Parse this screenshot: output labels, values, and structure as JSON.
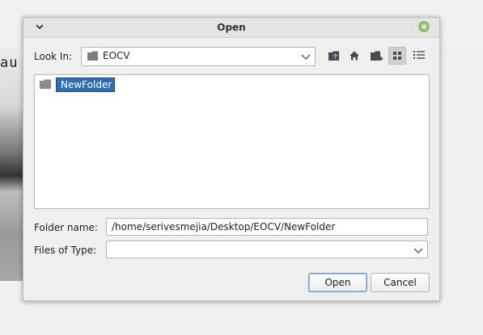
{
  "background": {
    "text": "au"
  },
  "dialog": {
    "title": "Open",
    "look_in_label": "Look In:",
    "look_in_value": "EOCV",
    "toolbar": [
      "up-one-level-icon",
      "home-icon",
      "new-folder-icon",
      "list-view-icon",
      "details-view-icon"
    ],
    "active_view": "list",
    "files": [
      {
        "name": "NewFolder",
        "type": "folder",
        "selected": true,
        "editing": true
      }
    ],
    "folder_name_label": "Folder name:",
    "folder_name_value": "/home/serivesmejia/Desktop/EOCV/NewFolder",
    "files_of_type_label": "Files of Type:",
    "files_of_type_value": "",
    "open_label": "Open",
    "cancel_label": "Cancel",
    "accent_color": "#2f6db2"
  }
}
